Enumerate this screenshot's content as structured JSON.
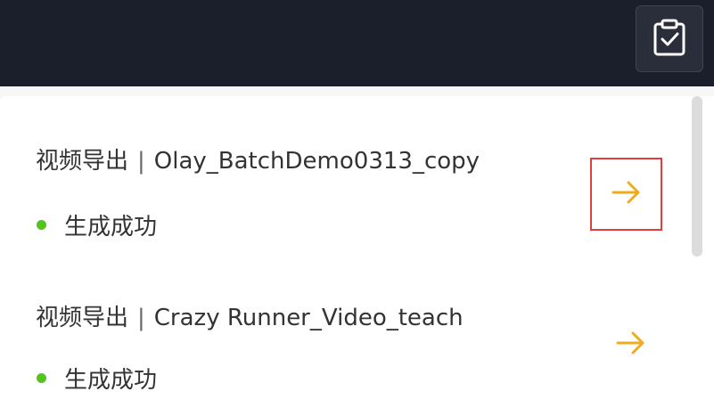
{
  "header": {
    "task_icon": "clipboard-check-icon"
  },
  "tasks": [
    {
      "type_label": "视频导出",
      "separator": "|",
      "name": "Olay_BatchDemo0313_copy",
      "status": "生成成功",
      "status_color": "#52c41a",
      "action_icon": "arrow-right-icon"
    },
    {
      "type_label": "视频导出",
      "separator": "|",
      "name": "Crazy Runner_Video_teach",
      "status": "生成成功",
      "status_color": "#52c41a",
      "action_icon": "arrow-right-icon"
    }
  ],
  "colors": {
    "topbar_bg": "#1b1f2b",
    "accent_arrow": "#f0ac1f",
    "success": "#52c41a",
    "highlight_border": "#e23c3c"
  }
}
